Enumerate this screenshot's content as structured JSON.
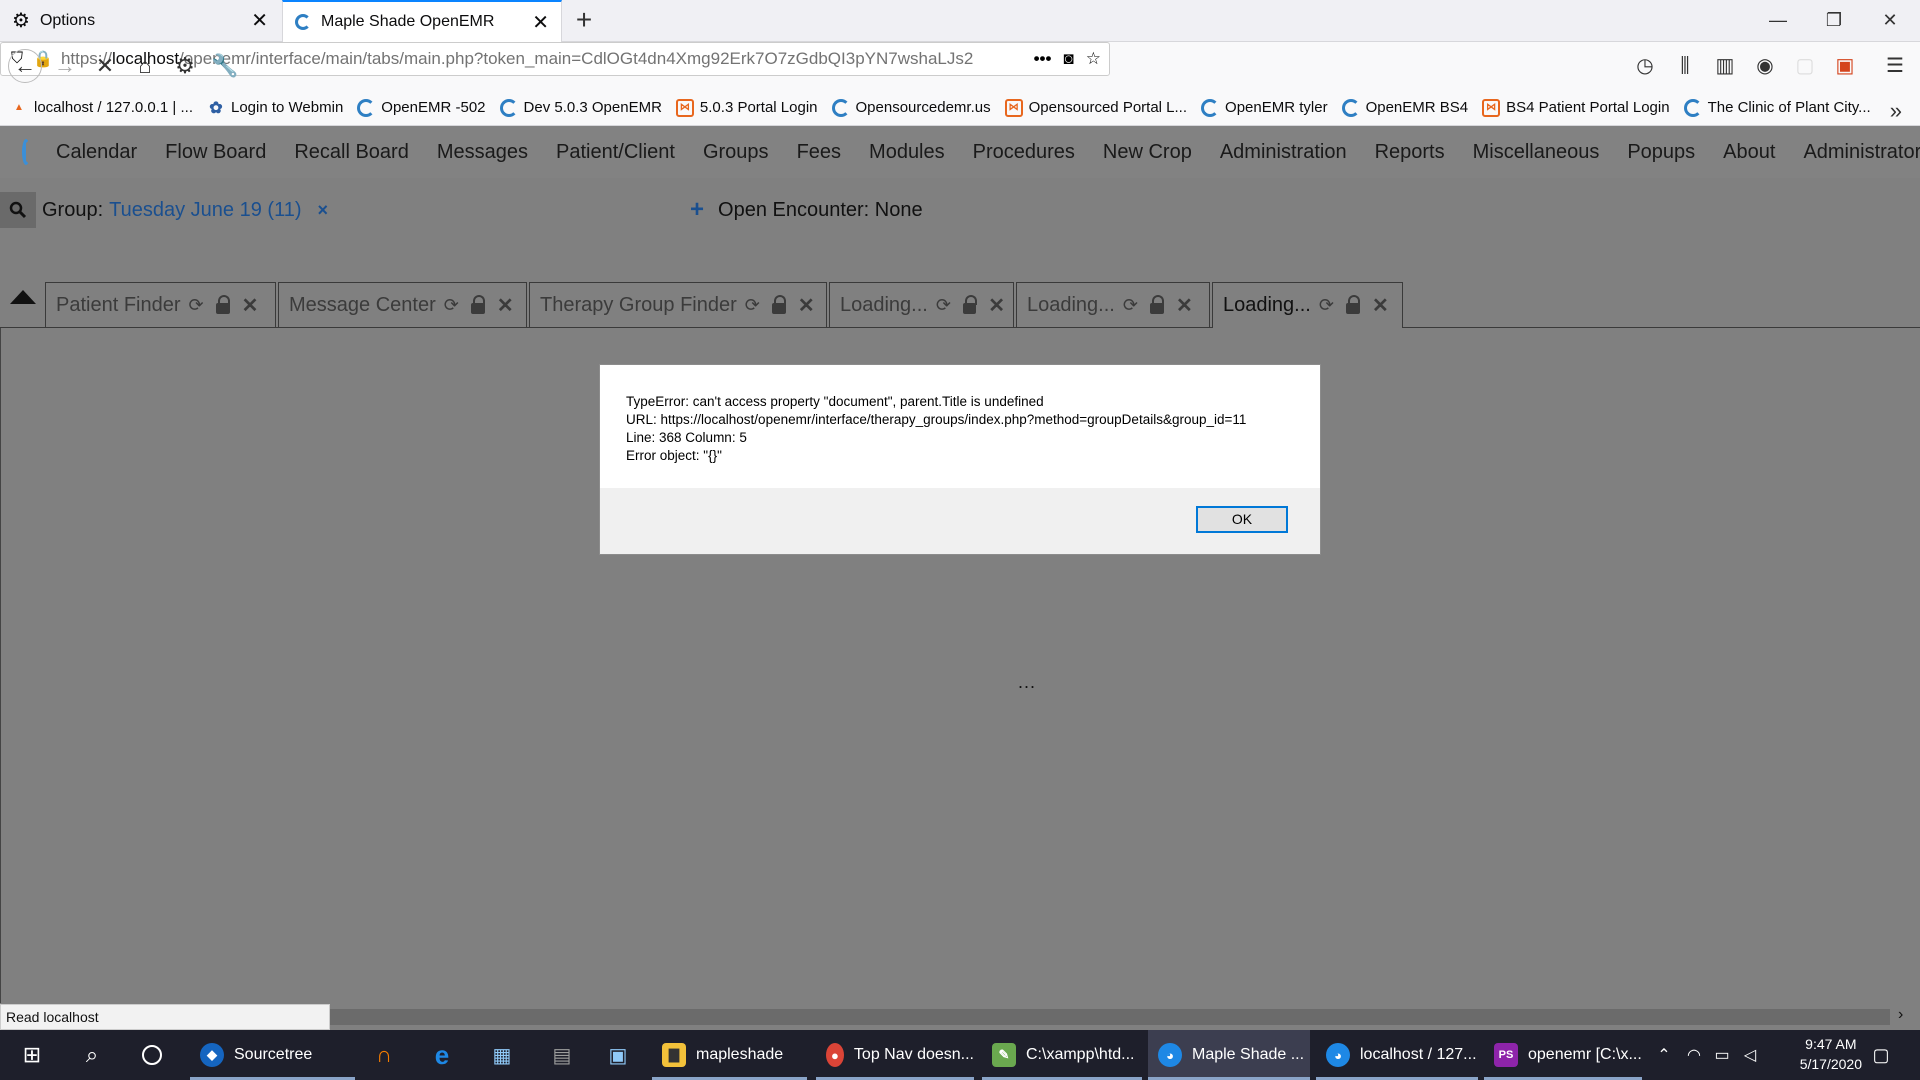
{
  "browser": {
    "tabs": [
      {
        "label": "Options",
        "icon": "gear-icon"
      },
      {
        "label": "Maple Shade OpenEMR",
        "icon": "openemr-icon",
        "active": true
      }
    ],
    "url_prefix": "https://",
    "url_host": "localhost",
    "url_path": "/openemr/interface/main/tabs/main.php?token_main=CdlOGt4dn4Xmg92Erk7O7zGdbQI3pYN7wshaLJs2",
    "url_more": "•••",
    "bookmarks": [
      {
        "label": "localhost / 127.0.0.1 | ...",
        "icon": "pma"
      },
      {
        "label": "Login to Webmin",
        "icon": "webmin"
      },
      {
        "label": "OpenEMR -502",
        "icon": "ring"
      },
      {
        "label": "Dev 5.0.3 OpenEMR",
        "icon": "ring"
      },
      {
        "label": "5.0.3 Portal Login",
        "icon": "box"
      },
      {
        "label": "Opensourcedemr.us",
        "icon": "ring"
      },
      {
        "label": "Opensourced Portal L...",
        "icon": "box"
      },
      {
        "label": "OpenEMR tyler",
        "icon": "ring"
      },
      {
        "label": "OpenEMR BS4",
        "icon": "ring"
      },
      {
        "label": "BS4 Patient Portal Login",
        "icon": "box"
      },
      {
        "label": "The Clinic of Plant City...",
        "icon": "ring"
      }
    ]
  },
  "app": {
    "menu": [
      "Calendar",
      "Flow Board",
      "Recall Board",
      "Messages",
      "Patient/Client",
      "Groups",
      "Fees",
      "Modules",
      "Procedures",
      "New Crop",
      "Administration",
      "Reports",
      "Miscellaneous",
      "Popups",
      "About",
      "Administrator Ac"
    ],
    "group_label": "Group:",
    "group_value": "Tuesday June 19 (11)",
    "group_close": "×",
    "encounter": "Open Encounter: None",
    "tabs": [
      {
        "label": "Patient Finder"
      },
      {
        "label": "Message Center"
      },
      {
        "label": "Therapy Group Finder"
      },
      {
        "label": "Loading..."
      },
      {
        "label": "Loading..."
      },
      {
        "label": "Loading...",
        "active": true
      }
    ],
    "loading_dots": "..."
  },
  "dialog": {
    "lines": [
      "TypeError: can't access property \"document\", parent.Title is undefined",
      "URL: https://localhost/openemr/interface/therapy_groups/index.php?method=groupDetails&group_id=11",
      "Line: 368 Column: 5",
      "Error object: \"{}\""
    ],
    "ok_label": "OK"
  },
  "status_text": "Read localhost",
  "taskbar": {
    "apps": [
      {
        "label": "Sourcetree",
        "color": "#1565c0"
      },
      {
        "label": "mapleshade",
        "color": "#f3c13a"
      },
      {
        "label": "Top Nav doesn...",
        "color": "#db4437"
      },
      {
        "label": "C:\\xampp\\htd...",
        "color": "#6aa84f"
      },
      {
        "label": "Maple Shade ...",
        "color": "#1e88e5",
        "active": true
      },
      {
        "label": "localhost / 127...",
        "color": "#1e88e5"
      },
      {
        "label": "openemr [C:\\x...",
        "color": "#8e24aa"
      }
    ],
    "time": "9:47 AM",
    "date": "5/17/2020"
  }
}
